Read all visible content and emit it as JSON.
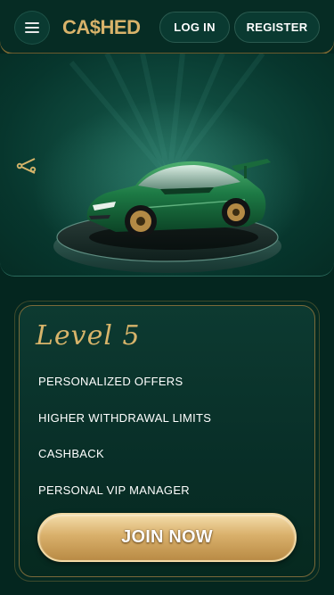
{
  "header": {
    "logo_text": "CA$HED",
    "login_label": "LOG IN",
    "register_label": "REGISTER"
  },
  "hero": {
    "image": "green-sports-car-on-platform"
  },
  "level": {
    "title": "Level 5",
    "benefits": [
      "PERSONALIZED OFFERS",
      "HIGHER WITHDRAWAL LIMITS",
      "CASHBACK",
      "PERSONAL VIP MANAGER"
    ],
    "join_label": "JOIN NOW"
  },
  "colors": {
    "background": "#04261f",
    "gold": "#d7b46a",
    "button_gold": "#d9b06b"
  }
}
